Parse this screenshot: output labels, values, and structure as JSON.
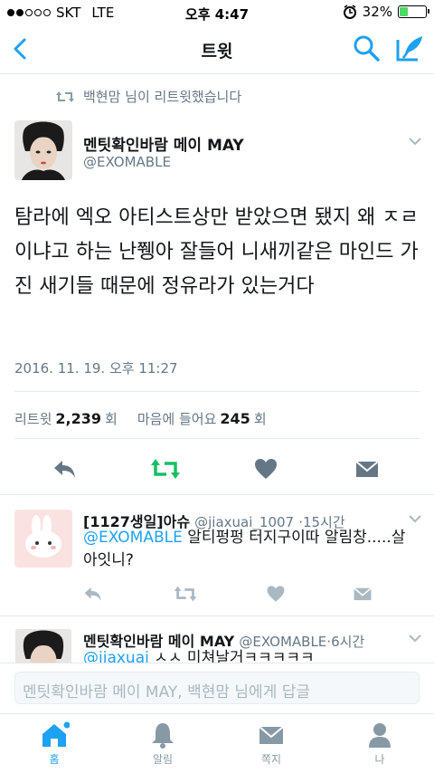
{
  "status_bar": {
    "carrier": "SKT",
    "network": "LTE",
    "time": "오후 4:47",
    "battery": "32%",
    "battery_level": 0.32
  },
  "nav": {
    "title": "트윗",
    "back_icon": "chevron-left-icon",
    "search_icon": "search-icon",
    "compose_icon": "compose-icon"
  },
  "retweet_context": {
    "text": "백현맘 님이 리트윗했습니다",
    "icon": "retweet-icon"
  },
  "tweet": {
    "name": "멘팃확인바람 메이 MAY",
    "handle": "@EXOMABLE",
    "text": "탐라에 엑오 아티스트상만 받았으면 됐지 왜 ㅈㄹ이냐고 하는 난쮕아 잘들어 니새끼같은 마인드 가진 새기들 때문에 정유라가 있는거다",
    "timestamp": "2016. 11. 19. 오후 11:27",
    "retweets_label": "리트윗",
    "retweets_count": "2,239",
    "retweets_suffix": "회",
    "likes_label": "마음에 들어요",
    "likes_count": "245",
    "likes_suffix": "회"
  },
  "replies": [
    {
      "name": "[1127생일]아슈",
      "handle": "@jiaxuai_1007",
      "sep": "·",
      "time": "15시간",
      "mention": "@EXOMABLE",
      "text": " 알티펑펑 터지구이따 알림창.....살아잇니?"
    },
    {
      "name": "멘팃확인바람 메이 MAY",
      "handle": "@EXOMABLE",
      "sep": "·",
      "time": "6시간",
      "mention": "@jiaxuai",
      "text": " ㅅㅅ 미쳐날거ㅋㅋㅋㅋㅋ"
    }
  ],
  "reply_input": {
    "placeholder": "멘팃확인바람 메이 MAY, 백현맘 님에게 답글"
  },
  "tabs": [
    {
      "label": "홈",
      "icon": "home-icon"
    },
    {
      "label": "알림",
      "icon": "bell-icon"
    },
    {
      "label": "쪽지",
      "icon": "envelope-icon"
    },
    {
      "label": "나",
      "icon": "person-icon"
    }
  ],
  "colors": {
    "accent": "#1da1f2",
    "retweet": "#17bf63",
    "gray": "#657786",
    "icon_gray": "#8899a6"
  }
}
